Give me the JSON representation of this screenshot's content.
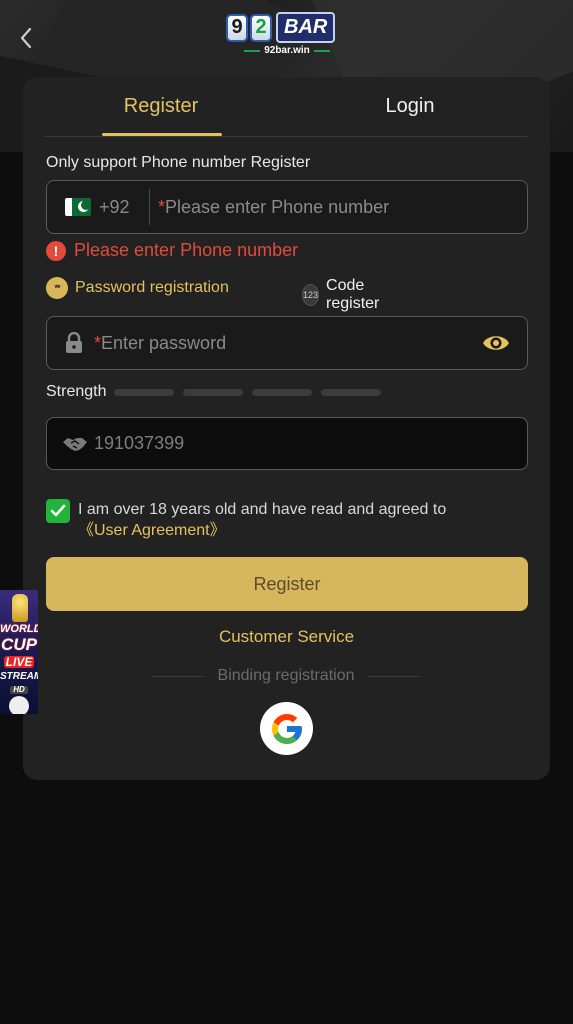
{
  "header": {
    "logo_digits": [
      "9",
      "2"
    ],
    "logo_word": "BAR",
    "logo_domain": "92bar.win"
  },
  "tabs": [
    {
      "label": "Register",
      "active": true
    },
    {
      "label": "Login",
      "active": false
    }
  ],
  "form": {
    "phone_label": "Only support Phone number Register",
    "country_code": "+92",
    "required_mark": "*",
    "phone_placeholder": "Please enter Phone number",
    "phone_error": "Please enter Phone number",
    "error_icon_glyph": "!",
    "mode_password_icon": "**",
    "mode_password_label": "Password registration",
    "mode_code_icon": "123",
    "mode_code_label": "Code register",
    "password_placeholder": "Enter password",
    "strength_label": "Strength",
    "strength_level": 0,
    "invite_code_value": "191037399",
    "agreement_text": "I am over 18 years old and have read and agreed to",
    "agreement_link": "《User Agreement》",
    "agreement_checked": true,
    "register_button": "Register",
    "customer_service": "Customer Service",
    "binding_label": "Binding registration"
  },
  "promo": {
    "line1": "WORLD",
    "line2": "CUP",
    "line3": "LIVE",
    "line4": "STREAM",
    "line5": "HD"
  },
  "colors": {
    "accent_gold": "#e3c25f",
    "button_gold": "#d6b75d",
    "error_red": "#e14a3c",
    "check_green": "#22b33a",
    "card_bg": "#222222",
    "page_bg": "#0d0d0d"
  }
}
